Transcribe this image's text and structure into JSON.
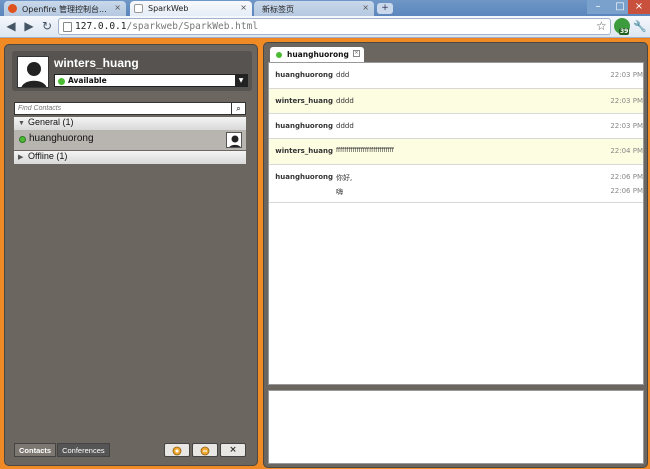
{
  "browser": {
    "tabs": [
      {
        "label": "Openfire 管理控制台..."
      },
      {
        "label": "SparkWeb"
      },
      {
        "label": "新标签页"
      }
    ],
    "url_host": "127.0.0.1",
    "url_path": "/sparkweb/SparkWeb.html",
    "extension_badge": "39"
  },
  "roster": {
    "username": "winters_huang",
    "status": "Available",
    "search_placeholder": "Find Contacts",
    "groups": [
      {
        "label": "General (1)"
      },
      {
        "label": "Offline (1)"
      }
    ],
    "contact_name": "huanghuorong",
    "bottom_tabs": [
      "Contacts",
      "Conferences"
    ],
    "close_glyph": "×"
  },
  "chat": {
    "tab_label": "huanghuorong",
    "messages": [
      {
        "user": "huanghuorong",
        "lines": [
          {
            "text": "ddd",
            "time": "22:03 PM"
          }
        ]
      },
      {
        "user": "winters_huang",
        "lines": [
          {
            "text": "dddd",
            "time": "22:03 PM"
          }
        ]
      },
      {
        "user": "huanghuorong",
        "lines": [
          {
            "text": "dddd",
            "time": "22:03 PM"
          }
        ]
      },
      {
        "user": "winters_huang",
        "lines": [
          {
            "text": "ffffffffffffffffffffffffffff",
            "time": "22:04 PM"
          }
        ]
      },
      {
        "user": "huanghuorong",
        "lines": [
          {
            "text": "你好,",
            "time": "22:06 PM"
          },
          {
            "text": "嗨",
            "time": "22:06 PM"
          }
        ]
      }
    ]
  }
}
